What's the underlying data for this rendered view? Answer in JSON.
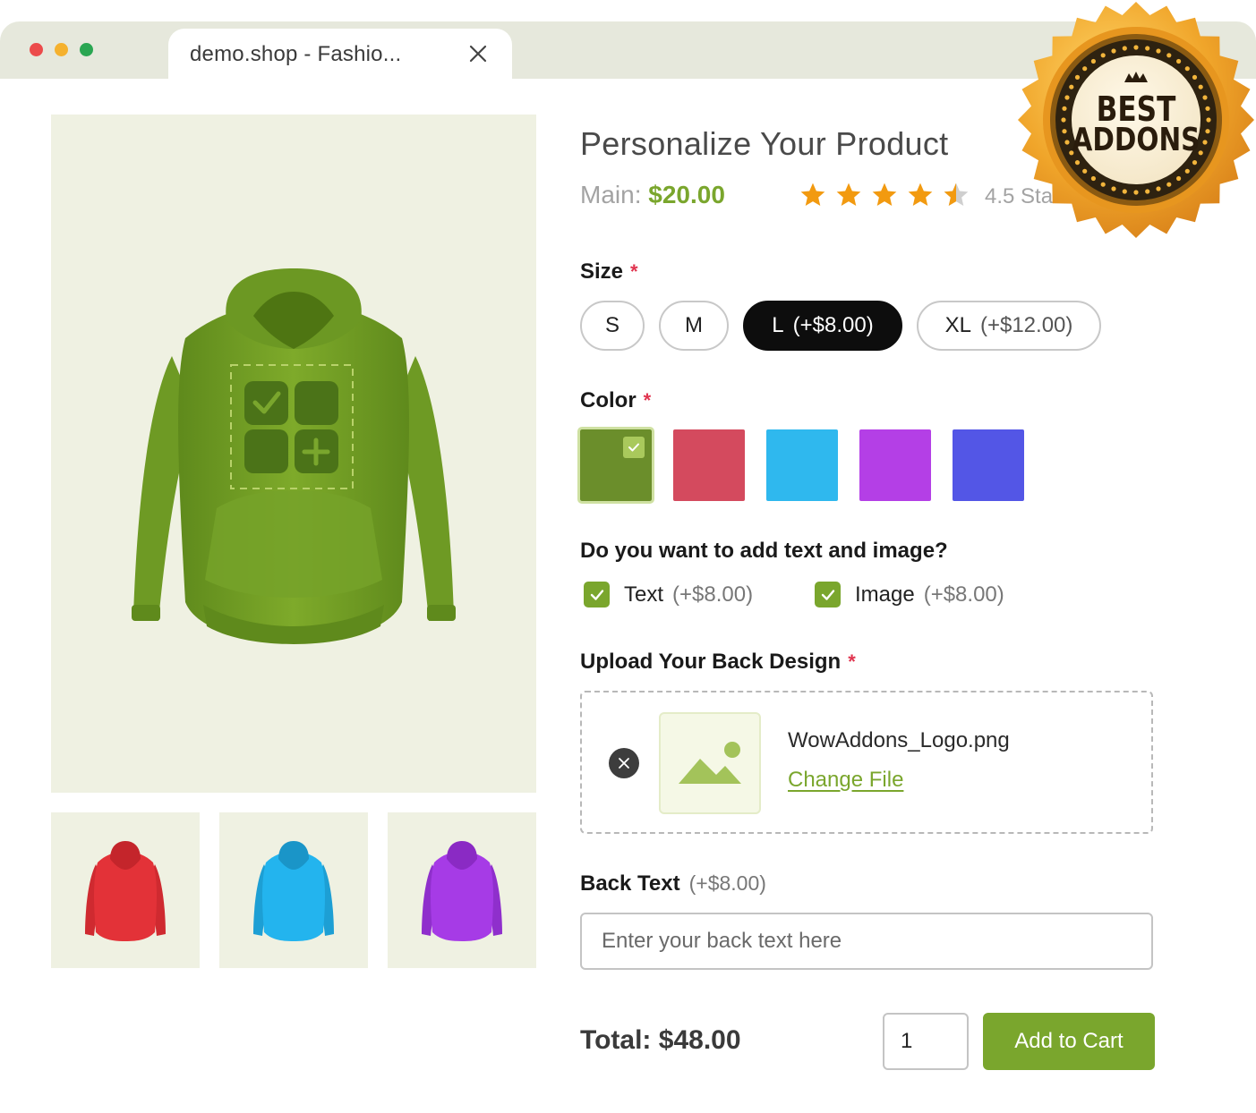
{
  "browser": {
    "tab_title": "demo.shop - Fashio...",
    "window_dots": [
      "#ec4b4b",
      "#f5b12e",
      "#2aa652"
    ]
  },
  "gallery": {
    "main_color": "#7aa628",
    "thumbnails": [
      {
        "name": "red-hoodie",
        "color": "#e33238"
      },
      {
        "name": "blue-hoodie",
        "color": "#23b4ee"
      },
      {
        "name": "purple-hoodie",
        "color": "#a63be6"
      }
    ]
  },
  "product": {
    "title": "Personalize Your Product",
    "price_label": "Main:",
    "price": "$20.00",
    "rating": 4.5,
    "rating_max": 5,
    "rating_text": "4.5 Star"
  },
  "size": {
    "label": "Size",
    "required": "*",
    "options": [
      {
        "label": "S",
        "extra": ""
      },
      {
        "label": "M",
        "extra": ""
      },
      {
        "label": "L",
        "extra": "(+$8.00)",
        "selected": true
      },
      {
        "label": "XL",
        "extra": "(+$12.00)"
      }
    ]
  },
  "color": {
    "label": "Color",
    "required": "*",
    "swatches": [
      "#6b8e2b",
      "#d44a5e",
      "#2fb8ee",
      "#b43fe6",
      "#5356e6"
    ],
    "selected_index": 0
  },
  "addons": {
    "question": "Do you want to add text and image?",
    "options": [
      {
        "label": "Text",
        "extra": "(+$8.00)",
        "checked": true
      },
      {
        "label": "Image",
        "extra": "(+$8.00)",
        "checked": true
      }
    ]
  },
  "upload": {
    "label": "Upload Your Back Design",
    "required": "*",
    "file_name": "WowAddons_Logo.png",
    "change_label": "Change File"
  },
  "back_text": {
    "label": "Back Text",
    "extra": "(+$8.00)",
    "placeholder": "Enter your back text here"
  },
  "cart": {
    "total_label": "Total: $48.00",
    "quantity": "1",
    "button_label": "Add to Cart"
  },
  "badge": {
    "line1": "BEST",
    "line2": "ADDONS"
  },
  "accent_color": "#7aa62d",
  "required_color": "#e0344f"
}
